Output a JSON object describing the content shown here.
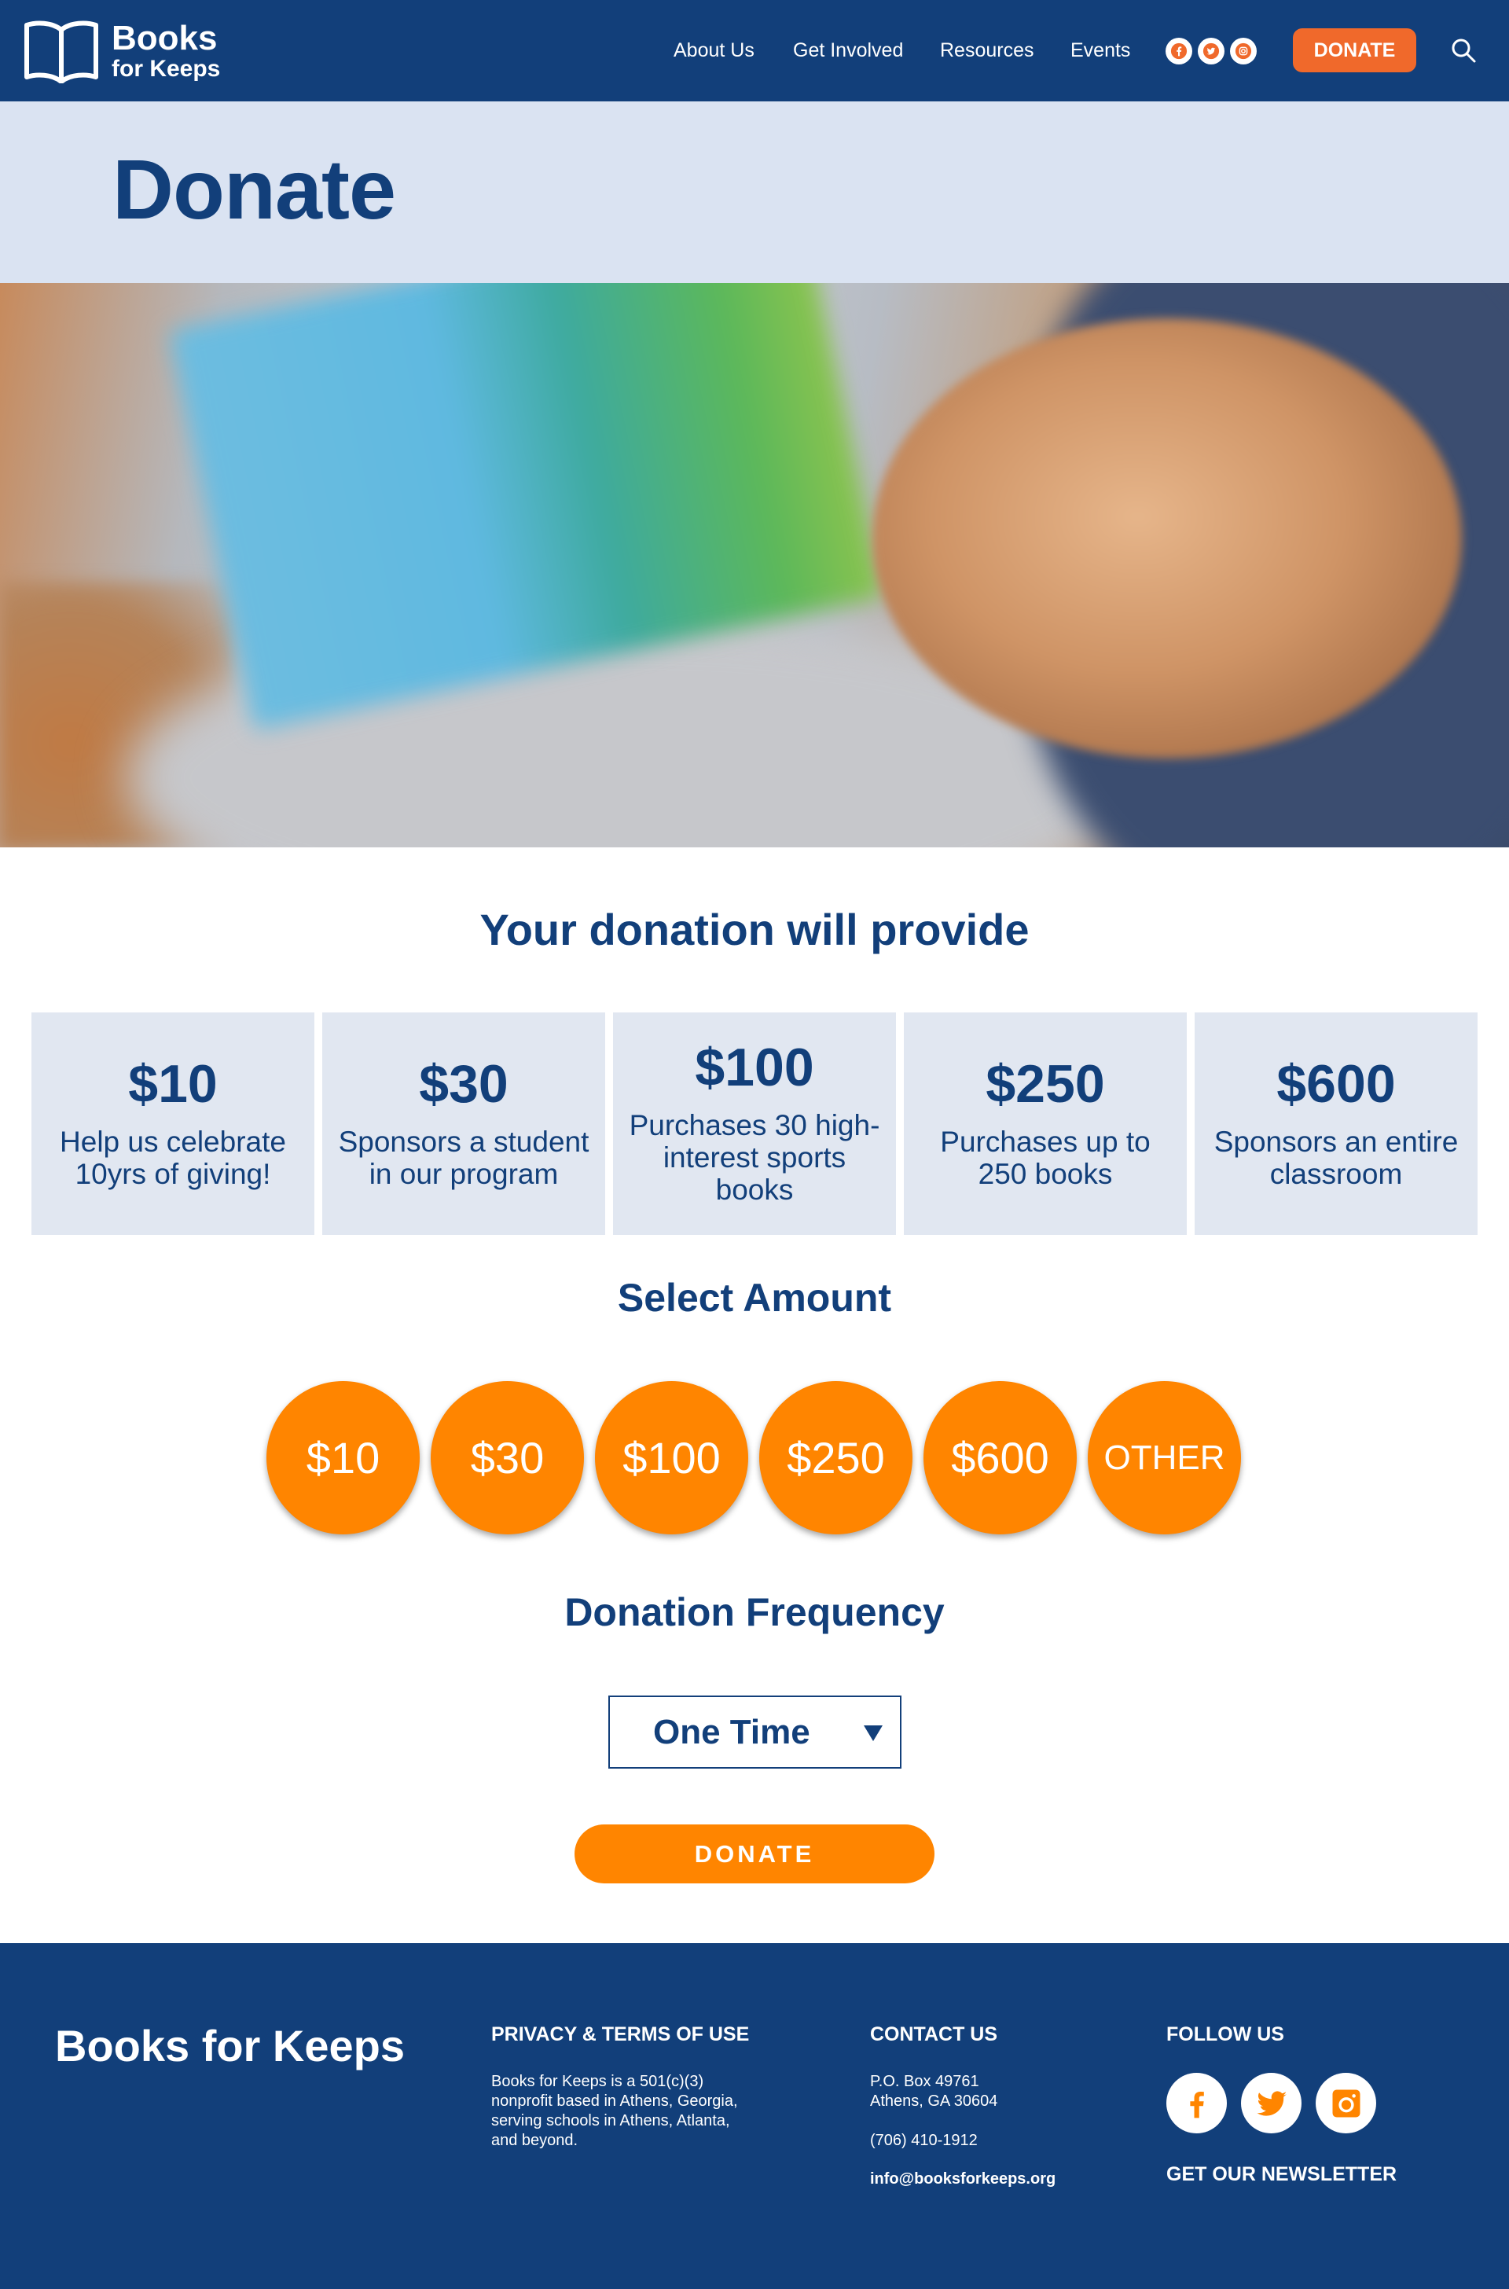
{
  "header": {
    "logo_line1": "Books",
    "logo_line2": "for Keeps",
    "nav": [
      "About Us",
      "Get Involved",
      "Resources",
      "Events"
    ],
    "donate_label": "DONATE",
    "social": [
      "facebook-icon",
      "twitter-icon",
      "instagram-icon"
    ]
  },
  "page": {
    "title": "Donate"
  },
  "provide": {
    "title": "Your donation will provide",
    "cards": [
      {
        "amount": "$10",
        "desc": "Help us celebrate 10yrs of giving!"
      },
      {
        "amount": "$30",
        "desc": "Sponsors a student in our program"
      },
      {
        "amount": "$100",
        "desc": "Purchases 30 high-interest sports books"
      },
      {
        "amount": "$250",
        "desc": "Purchases up to 250 books"
      },
      {
        "amount": "$600",
        "desc": "Sponsors an entire classroom"
      }
    ]
  },
  "select_amount": {
    "title": "Select Amount",
    "options": [
      "$10",
      "$30",
      "$100",
      "$250",
      "$600",
      "OTHER"
    ]
  },
  "frequency": {
    "title": "Donation Frequency",
    "selected": "One Time"
  },
  "donate_button": "DONATE",
  "footer": {
    "brand": "Books for Keeps",
    "privacy_heading": "PRIVACY & TERMS OF USE",
    "privacy_text": [
      "Books for Keeps is a 501(c)(3)",
      "nonprofit based in Athens, Georgia,",
      "serving schools in Athens, Atlanta,",
      "and beyond."
    ],
    "contact_heading": "CONTACT US",
    "address_line1": "P.O. Box 49761",
    "address_line2": "Athens, GA 30604",
    "phone": "(706) 410-1912",
    "email": "info@booksforkeeps.org",
    "follow_heading": "FOLLOW US",
    "newsletter": "GET OUR NEWSLETTER"
  },
  "colors": {
    "navy": "#123f7a",
    "light_band": "#dae3f2",
    "card_bg": "#e1e7f1",
    "orange": "#ff8500",
    "header_donate": "#f0692b"
  }
}
